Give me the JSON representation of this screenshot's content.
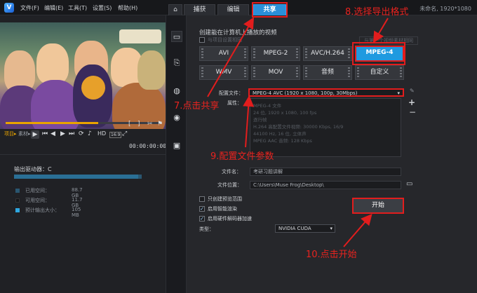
{
  "app": {
    "logo": "V",
    "menus": [
      "文件(F)",
      "编辑(E)",
      "工具(T)",
      "设置(S)",
      "帮助(H)"
    ],
    "resolution": "未命名, 1920*1080"
  },
  "tabs": {
    "home_icon": "home-icon",
    "capture": "捕获",
    "edit": "编辑",
    "share": "共享",
    "active": "share"
  },
  "preview": {
    "project_label": "项目▸",
    "clip_label": "素材▸",
    "hd_label": "HD",
    "ratio_label": "16:9",
    "timecode": "00:00:00:00",
    "progress_fraction": 0.6
  },
  "output": {
    "drive_label": "输出驱动器：C",
    "used_fraction": 0.97,
    "legend": [
      {
        "label": "已用空间：",
        "value": "88.7 GB",
        "color": "#2a5670"
      },
      {
        "label": "可用空间：",
        "value": "11.7 GB",
        "color": "#15161a"
      },
      {
        "label": "预计输出大小：",
        "value": "105 MB",
        "color": "#2ea7e0"
      }
    ]
  },
  "share": {
    "heading": "创建能在计算机上播放的视频",
    "sub_option": "与项目设置相同",
    "sub_option_right": "与第一个视频素材相同",
    "formats_row1": [
      "AVI",
      "MPEG-2",
      "AVC/H.264",
      "MPEG-4"
    ],
    "formats_row2": [
      "WMV",
      "MOV",
      "音频",
      "自定义"
    ],
    "selected_format": "MPEG-4",
    "profile_label": "配置文件：",
    "profile_value": "MPEG-4 AVC (1920 x 1080, 100p, 30Mbps)",
    "properties_label": "属性：",
    "properties": [
      "MPEG-4 文件",
      "24 位, 1920 x 1080, 100 fps",
      "逐行帧",
      "H.264 高配置文件视频: 30000 Kbps, 16/9",
      "44100 Hz, 16 位, 立体声",
      "MPEG AAC 音频: 128 Kbps"
    ],
    "filename_label": "文件名：",
    "filename_value": "考研习题讲解",
    "location_label": "文件位置：",
    "location_value": "C:\\Users\\Muse Frog\\Desktop\\",
    "checkboxes": [
      {
        "label": "只创建预览范围",
        "checked": false
      },
      {
        "label": "启用智能渲染",
        "checked": true
      },
      {
        "label": "启用硬件解码器加速",
        "checked": true
      }
    ],
    "type_label": "类型：",
    "type_value": "NVIDIA CUDA",
    "start_button": "开始"
  },
  "annotations": {
    "a7": "7.点击共享",
    "a8": "8.选择导出格式",
    "a9": "9.配置文件参数",
    "a10": "10.点击开始",
    "color": "#e21d1d"
  }
}
